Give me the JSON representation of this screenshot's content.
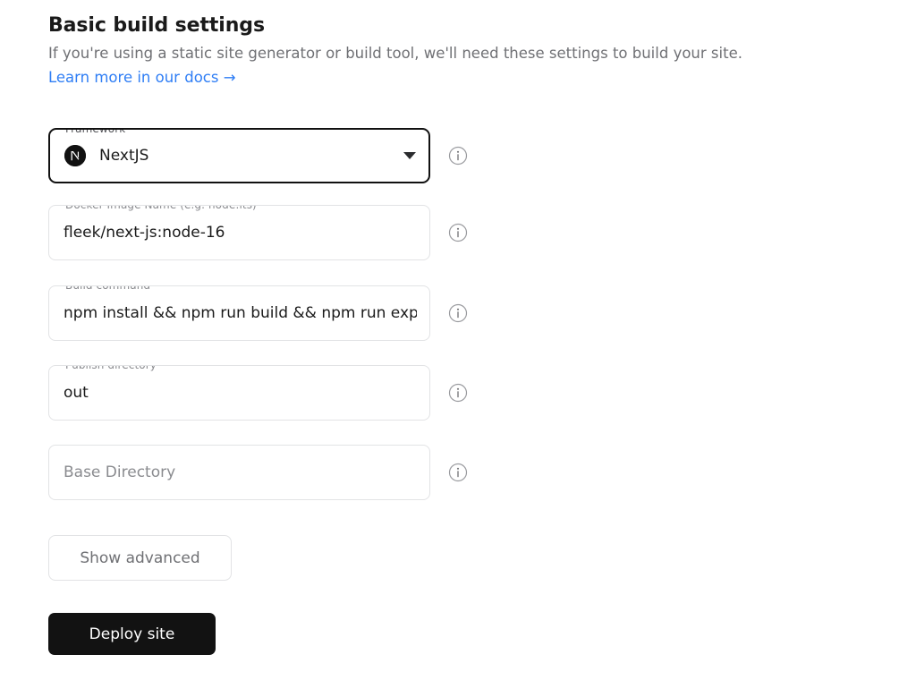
{
  "header": {
    "title": "Basic build settings",
    "subtitle": "If you're using a static site generator or build tool, we'll need these settings to build your site.",
    "docs_link": "Learn more in our docs →"
  },
  "fields": [
    {
      "name": "framework",
      "label": "Framework",
      "value": "NextJS",
      "placeholder": "",
      "type": "select",
      "focused": true,
      "icon": "nextjs-logo-icon",
      "has_info": true,
      "info_icon": "info-icon"
    },
    {
      "name": "docker-image-name",
      "label": "Docker Image Name (e.g. node:lts)",
      "value": "fleek/next-js:node-16",
      "placeholder": "",
      "type": "text",
      "focused": false,
      "has_info": true,
      "info_icon": "info-icon"
    },
    {
      "name": "build-command",
      "label": "Build command",
      "value": "npm install && npm run build && npm run export",
      "placeholder": "",
      "type": "text",
      "focused": false,
      "has_info": true,
      "info_icon": "info-icon"
    },
    {
      "name": "publish-directory",
      "label": "Publish directory",
      "value": "out",
      "placeholder": "",
      "type": "text",
      "focused": false,
      "has_info": true,
      "info_icon": "info-icon"
    },
    {
      "name": "base-directory",
      "label": "",
      "value": "",
      "placeholder": "Base Directory",
      "type": "text",
      "focused": false,
      "has_info": true,
      "info_icon": "info-icon"
    }
  ],
  "buttons": {
    "show_advanced": "Show advanced",
    "deploy_site": "Deploy site"
  },
  "colors": {
    "link": "#2f7ef5",
    "primary_button_bg": "#121212",
    "focus_border": "#111111",
    "field_border": "#e2e3e5",
    "muted_text": "#6f7074"
  }
}
